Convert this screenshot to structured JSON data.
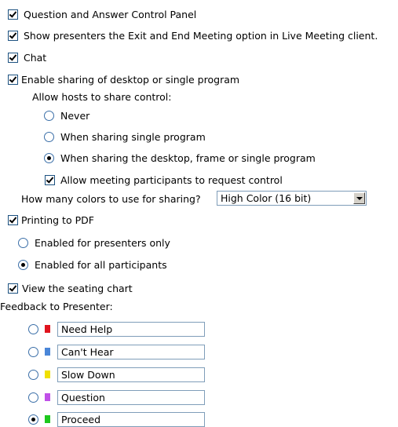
{
  "options": {
    "qa_panel": {
      "label": "Question and Answer Control Panel",
      "checked": true
    },
    "exit_end": {
      "label": "Show presenters the Exit and End Meeting option in Live Meeting client.",
      "checked": true
    },
    "chat": {
      "label": "Chat",
      "checked": true
    },
    "sharing": {
      "label": "Enable sharing of desktop or single program",
      "checked": true
    }
  },
  "host_control": {
    "title": "Allow hosts to share control:",
    "choices": [
      {
        "label": "Never",
        "selected": false
      },
      {
        "label": "When sharing single program",
        "selected": false
      },
      {
        "label": "When sharing the desktop, frame or single program",
        "selected": true
      }
    ],
    "request_control": {
      "label": "Allow meeting participants to request control",
      "checked": true
    }
  },
  "colors": {
    "label": "How many colors to use for sharing?",
    "selected": "High Color (16 bit)"
  },
  "pdf": {
    "label": "Printing to PDF",
    "checked": true,
    "choices": [
      {
        "label": "Enabled for presenters only",
        "selected": false
      },
      {
        "label": "Enabled for all participants",
        "selected": true
      }
    ]
  },
  "seating": {
    "label": "View the seating chart",
    "checked": true
  },
  "feedback": {
    "title": "Feedback to Presenter:",
    "items": [
      {
        "value": "Need Help",
        "color": "#e0141e",
        "selected": false
      },
      {
        "value": "Can't Hear",
        "color": "#4a86d8",
        "selected": false
      },
      {
        "value": "Slow Down",
        "color": "#f0e000",
        "selected": false
      },
      {
        "value": "Question",
        "color": "#c050e8",
        "selected": false
      },
      {
        "value": "Proceed",
        "color": "#1ec81e",
        "selected": true
      }
    ]
  }
}
